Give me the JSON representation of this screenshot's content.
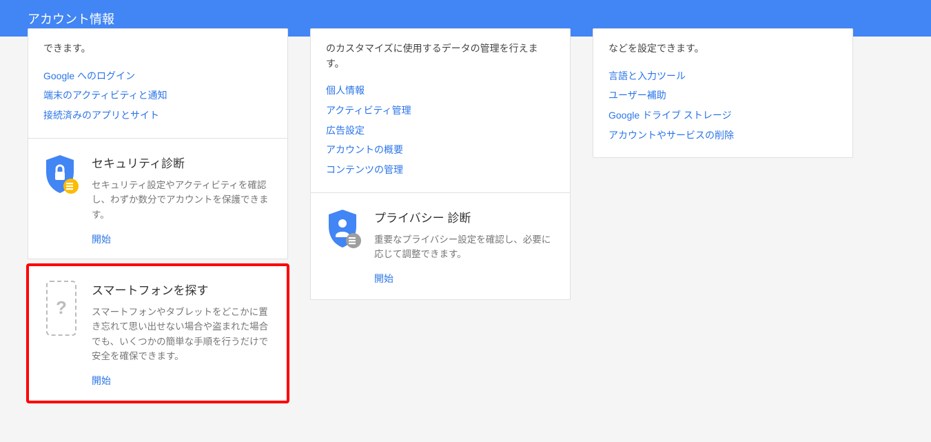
{
  "header": {
    "title": "アカウント情報"
  },
  "col1": {
    "desc_tail": "できます。",
    "links": [
      "Google へのログイン",
      "端末のアクティビティと通知",
      "接続済みのアプリとサイト"
    ],
    "security": {
      "title": "セキュリティ診断",
      "desc": "セキュリティ設定やアクティビティを確認し、わずか数分でアカウントを保護できます。",
      "start": "開始"
    },
    "findphone": {
      "title": "スマートフォンを探す",
      "desc": "スマートフォンやタブレットをどこかに置き忘れて思い出せない場合や盗まれた場合でも、いくつかの簡単な手順を行うだけで安全を確保できます。",
      "start": "開始",
      "icon_glyph": "?"
    }
  },
  "col2": {
    "desc_tail": "のカスタマイズに使用するデータの管理を行えます。",
    "links": [
      "個人情報",
      "アクティビティ管理",
      "広告設定",
      "アカウントの概要",
      "コンテンツの管理"
    ],
    "privacy": {
      "title": "プライバシー 診断",
      "desc": "重要なプライバシー設定を確認し、必要に応じて調整できます。",
      "start": "開始"
    }
  },
  "col3": {
    "desc_tail": "などを設定できます。",
    "links": [
      "言語と入力ツール",
      "ユーザー補助",
      "Google ドライブ ストレージ",
      "アカウントやサービスの削除"
    ]
  }
}
